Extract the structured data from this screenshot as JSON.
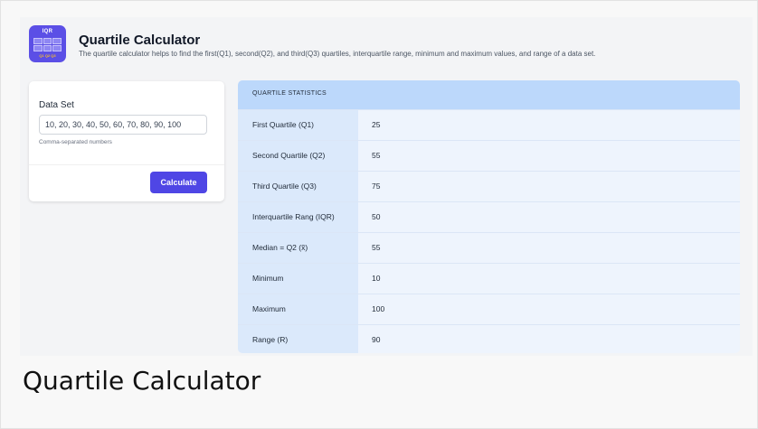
{
  "header": {
    "logo_text": "IQR",
    "logo_sub": "Q1 Q2 Q3",
    "title": "Quartile Calculator",
    "subtitle": "The quartile calculator helps to find the first(Q1), second(Q2), and third(Q3) quartiles, interquartile range, minimum and maximum values, and range of a data set."
  },
  "input_card": {
    "label": "Data Set",
    "value": "10, 20, 30, 40, 50, 60, 70, 80, 90, 100",
    "help": "Comma-separated numbers",
    "button_label": "Calculate"
  },
  "stats": {
    "heading": "QUARTILE STATISTICS",
    "rows": [
      {
        "label": "First Quartile (Q1)",
        "value": "25"
      },
      {
        "label": "Second Quartile (Q2)",
        "value": "55"
      },
      {
        "label": "Third Quartile (Q3)",
        "value": "75"
      },
      {
        "label": "Interquartile Rang (IQR)",
        "value": "50"
      },
      {
        "label": "Median = Q2 (x̃)",
        "value": "55"
      },
      {
        "label": "Minimum",
        "value": "10"
      },
      {
        "label": "Maximum",
        "value": "100"
      },
      {
        "label": "Range (R)",
        "value": "90"
      }
    ]
  },
  "page_heading": "Quartile Calculator",
  "colors": {
    "accent": "#4f46e5",
    "table_header": "#bcd8fb",
    "label_cell": "#dbe9fb"
  }
}
